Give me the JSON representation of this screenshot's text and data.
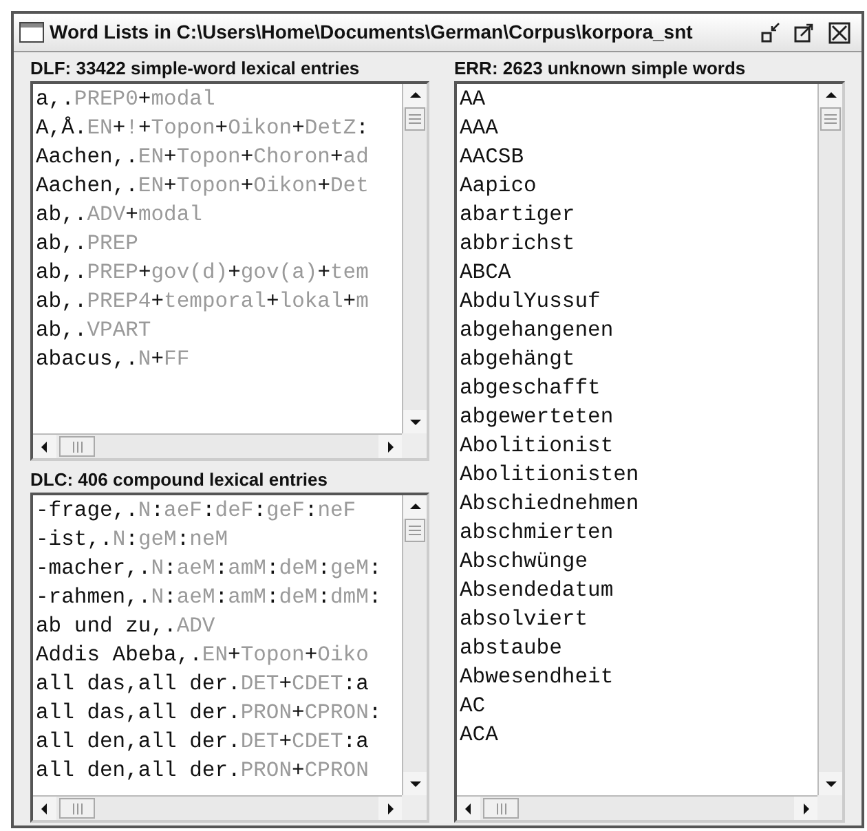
{
  "window": {
    "title": "Word Lists in C:\\Users\\Home\\Documents\\German\\Corpus\\korpora_snt"
  },
  "panels": [
    {
      "title": "DLF: 33422 simple-word lexical entries",
      "entries": [
        [
          {
            "text": "a,.",
            "kind": "plain"
          },
          {
            "text": "PREP0",
            "kind": "code"
          },
          {
            "text": "+",
            "kind": "plain"
          },
          {
            "text": "modal",
            "kind": "code"
          }
        ],
        [
          {
            "text": "A,Å.",
            "kind": "plain"
          },
          {
            "text": "EN",
            "kind": "code"
          },
          {
            "text": "+",
            "kind": "plain"
          },
          {
            "text": "!",
            "kind": "code"
          },
          {
            "text": "+",
            "kind": "plain"
          },
          {
            "text": "Topon",
            "kind": "code"
          },
          {
            "text": "+",
            "kind": "plain"
          },
          {
            "text": "Oikon",
            "kind": "code"
          },
          {
            "text": "+",
            "kind": "plain"
          },
          {
            "text": "DetZ",
            "kind": "code"
          },
          {
            "text": ":",
            "kind": "plain"
          }
        ],
        [
          {
            "text": "Aachen,.",
            "kind": "plain"
          },
          {
            "text": "EN",
            "kind": "code"
          },
          {
            "text": "+",
            "kind": "plain"
          },
          {
            "text": "Topon",
            "kind": "code"
          },
          {
            "text": "+",
            "kind": "plain"
          },
          {
            "text": "Choron",
            "kind": "code"
          },
          {
            "text": "+",
            "kind": "plain"
          },
          {
            "text": "ad",
            "kind": "code"
          }
        ],
        [
          {
            "text": "Aachen,.",
            "kind": "plain"
          },
          {
            "text": "EN",
            "kind": "code"
          },
          {
            "text": "+",
            "kind": "plain"
          },
          {
            "text": "Topon",
            "kind": "code"
          },
          {
            "text": "+",
            "kind": "plain"
          },
          {
            "text": "Oikon",
            "kind": "code"
          },
          {
            "text": "+",
            "kind": "plain"
          },
          {
            "text": "Det",
            "kind": "code"
          }
        ],
        [
          {
            "text": "ab,.",
            "kind": "plain"
          },
          {
            "text": "ADV",
            "kind": "code"
          },
          {
            "text": "+",
            "kind": "plain"
          },
          {
            "text": "modal",
            "kind": "code"
          }
        ],
        [
          {
            "text": "ab,.",
            "kind": "plain"
          },
          {
            "text": "PREP",
            "kind": "code"
          }
        ],
        [
          {
            "text": "ab,.",
            "kind": "plain"
          },
          {
            "text": "PREP",
            "kind": "code"
          },
          {
            "text": "+",
            "kind": "plain"
          },
          {
            "text": "gov(d)",
            "kind": "code"
          },
          {
            "text": "+",
            "kind": "plain"
          },
          {
            "text": "gov(a)",
            "kind": "code"
          },
          {
            "text": "+",
            "kind": "plain"
          },
          {
            "text": "tem",
            "kind": "code"
          }
        ],
        [
          {
            "text": "ab,.",
            "kind": "plain"
          },
          {
            "text": "PREP4",
            "kind": "code"
          },
          {
            "text": "+",
            "kind": "plain"
          },
          {
            "text": "temporal",
            "kind": "code"
          },
          {
            "text": "+",
            "kind": "plain"
          },
          {
            "text": "lokal",
            "kind": "code"
          },
          {
            "text": "+",
            "kind": "plain"
          },
          {
            "text": "m",
            "kind": "code"
          }
        ],
        [
          {
            "text": "ab,.",
            "kind": "plain"
          },
          {
            "text": "VPART",
            "kind": "code"
          }
        ],
        [
          {
            "text": "abacus,.",
            "kind": "plain"
          },
          {
            "text": "N",
            "kind": "code"
          },
          {
            "text": "+",
            "kind": "plain"
          },
          {
            "text": "FF",
            "kind": "code"
          }
        ]
      ]
    },
    {
      "title": "ERR: 2623 unknown simple words",
      "entries": [
        [
          {
            "text": "AA",
            "kind": "plain"
          }
        ],
        [
          {
            "text": "AAA",
            "kind": "plain"
          }
        ],
        [
          {
            "text": "AACSB",
            "kind": "plain"
          }
        ],
        [
          {
            "text": "Aapico",
            "kind": "plain"
          }
        ],
        [
          {
            "text": "abartiger",
            "kind": "plain"
          }
        ],
        [
          {
            "text": "abbrichst",
            "kind": "plain"
          }
        ],
        [
          {
            "text": "ABCA",
            "kind": "plain"
          }
        ],
        [
          {
            "text": "AbdulYussuf",
            "kind": "plain"
          }
        ],
        [
          {
            "text": "abgehangenen",
            "kind": "plain"
          }
        ],
        [
          {
            "text": "abgehängt",
            "kind": "plain"
          }
        ],
        [
          {
            "text": "abgeschafft",
            "kind": "plain"
          }
        ],
        [
          {
            "text": "abgewerteten",
            "kind": "plain"
          }
        ],
        [
          {
            "text": "Abolitionist",
            "kind": "plain"
          }
        ],
        [
          {
            "text": "Abolitionisten",
            "kind": "plain"
          }
        ],
        [
          {
            "text": "Abschiednehmen",
            "kind": "plain"
          }
        ],
        [
          {
            "text": "abschmierten",
            "kind": "plain"
          }
        ],
        [
          {
            "text": "Abschwünge",
            "kind": "plain"
          }
        ],
        [
          {
            "text": "Absendedatum",
            "kind": "plain"
          }
        ],
        [
          {
            "text": "absolviert",
            "kind": "plain"
          }
        ],
        [
          {
            "text": "abstaube",
            "kind": "plain"
          }
        ],
        [
          {
            "text": "Abwesendheit",
            "kind": "plain"
          }
        ],
        [
          {
            "text": "AC",
            "kind": "plain"
          }
        ],
        [
          {
            "text": "ACA",
            "kind": "plain"
          }
        ]
      ]
    },
    {
      "title": "DLC: 406 compound lexical entries",
      "entries": [
        [
          {
            "text": "-frage,.",
            "kind": "plain"
          },
          {
            "text": "N",
            "kind": "code"
          },
          {
            "text": ":",
            "kind": "plain"
          },
          {
            "text": "aeF",
            "kind": "code"
          },
          {
            "text": ":",
            "kind": "plain"
          },
          {
            "text": "deF",
            "kind": "code"
          },
          {
            "text": ":",
            "kind": "plain"
          },
          {
            "text": "geF",
            "kind": "code"
          },
          {
            "text": ":",
            "kind": "plain"
          },
          {
            "text": "neF",
            "kind": "code"
          }
        ],
        [
          {
            "text": "-ist,.",
            "kind": "plain"
          },
          {
            "text": "N",
            "kind": "code"
          },
          {
            "text": ":",
            "kind": "plain"
          },
          {
            "text": "geM",
            "kind": "code"
          },
          {
            "text": ":",
            "kind": "plain"
          },
          {
            "text": "neM",
            "kind": "code"
          }
        ],
        [
          {
            "text": "-macher,.",
            "kind": "plain"
          },
          {
            "text": "N",
            "kind": "code"
          },
          {
            "text": ":",
            "kind": "plain"
          },
          {
            "text": "aeM",
            "kind": "code"
          },
          {
            "text": ":",
            "kind": "plain"
          },
          {
            "text": "amM",
            "kind": "code"
          },
          {
            "text": ":",
            "kind": "plain"
          },
          {
            "text": "deM",
            "kind": "code"
          },
          {
            "text": ":",
            "kind": "plain"
          },
          {
            "text": "geM",
            "kind": "code"
          },
          {
            "text": ":",
            "kind": "plain"
          }
        ],
        [
          {
            "text": "-rahmen,.",
            "kind": "plain"
          },
          {
            "text": "N",
            "kind": "code"
          },
          {
            "text": ":",
            "kind": "plain"
          },
          {
            "text": "aeM",
            "kind": "code"
          },
          {
            "text": ":",
            "kind": "plain"
          },
          {
            "text": "amM",
            "kind": "code"
          },
          {
            "text": ":",
            "kind": "plain"
          },
          {
            "text": "deM",
            "kind": "code"
          },
          {
            "text": ":",
            "kind": "plain"
          },
          {
            "text": "dmM",
            "kind": "code"
          },
          {
            "text": ":",
            "kind": "plain"
          }
        ],
        [
          {
            "text": "ab und zu,.",
            "kind": "plain"
          },
          {
            "text": "ADV",
            "kind": "code"
          }
        ],
        [
          {
            "text": "Addis Abeba,.",
            "kind": "plain"
          },
          {
            "text": "EN",
            "kind": "code"
          },
          {
            "text": "+",
            "kind": "plain"
          },
          {
            "text": "Topon",
            "kind": "code"
          },
          {
            "text": "+",
            "kind": "plain"
          },
          {
            "text": "Oiko",
            "kind": "code"
          }
        ],
        [
          {
            "text": "all das,all der.",
            "kind": "plain"
          },
          {
            "text": "DET",
            "kind": "code"
          },
          {
            "text": "+",
            "kind": "plain"
          },
          {
            "text": "CDET",
            "kind": "code"
          },
          {
            "text": ":a",
            "kind": "plain"
          }
        ],
        [
          {
            "text": "all das,all der.",
            "kind": "plain"
          },
          {
            "text": "PRON",
            "kind": "code"
          },
          {
            "text": "+",
            "kind": "plain"
          },
          {
            "text": "CPRON",
            "kind": "code"
          },
          {
            "text": ":",
            "kind": "plain"
          }
        ],
        [
          {
            "text": "all den,all der.",
            "kind": "plain"
          },
          {
            "text": "DET",
            "kind": "code"
          },
          {
            "text": "+",
            "kind": "plain"
          },
          {
            "text": "CDET",
            "kind": "code"
          },
          {
            "text": ":a",
            "kind": "plain"
          }
        ],
        [
          {
            "text": "all den,all der.",
            "kind": "plain"
          },
          {
            "text": "PRON",
            "kind": "code"
          },
          {
            "text": "+",
            "kind": "plain"
          },
          {
            "text": "CPRON",
            "kind": "code"
          }
        ]
      ]
    }
  ]
}
